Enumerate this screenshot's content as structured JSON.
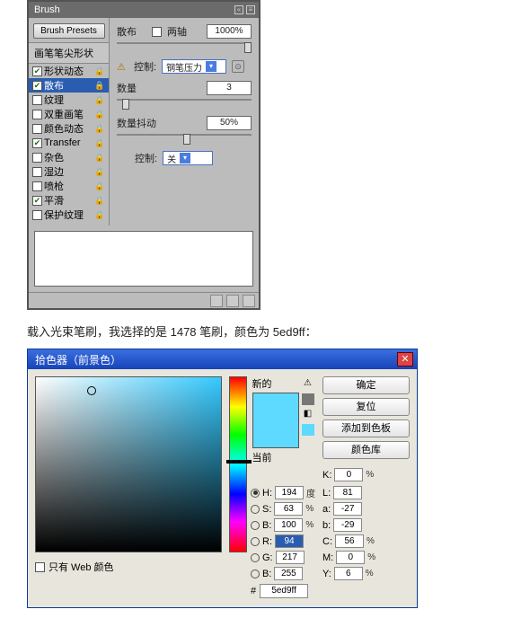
{
  "brush": {
    "title": "Brush",
    "presets_button": "Brush Presets",
    "sidebar_head": "画笔笔尖形状",
    "items": [
      {
        "label": "形状动态",
        "checked": true,
        "locked": true,
        "key": "shape-dynamics"
      },
      {
        "label": "散布",
        "checked": true,
        "locked": true,
        "key": "scatter",
        "selected": true
      },
      {
        "label": "纹理",
        "checked": false,
        "locked": true,
        "key": "texture"
      },
      {
        "label": "双重画笔",
        "checked": false,
        "locked": true,
        "key": "dual-brush"
      },
      {
        "label": "颜色动态",
        "checked": false,
        "locked": true,
        "key": "color-dynamics"
      },
      {
        "label": "Transfer",
        "checked": true,
        "locked": true,
        "key": "transfer"
      },
      {
        "label": "杂色",
        "checked": false,
        "locked": true,
        "key": "noise"
      },
      {
        "label": "湿边",
        "checked": false,
        "locked": true,
        "key": "wet-edges"
      },
      {
        "label": "喷枪",
        "checked": false,
        "locked": true,
        "key": "airbrush"
      },
      {
        "label": "平滑",
        "checked": true,
        "locked": true,
        "key": "smoothing"
      },
      {
        "label": "保护纹理",
        "checked": false,
        "locked": true,
        "key": "protect-texture"
      }
    ],
    "scatter": {
      "scatter_label": "散布",
      "both_axes_label": "两轴",
      "both_axes_checked": false,
      "scatter_value": "1000%",
      "control1_label": "控制:",
      "control1_value": "钢笔压力",
      "count_label": "数量",
      "count_value": "3",
      "jitter_label": "数量抖动",
      "jitter_value": "50%",
      "control2_label": "控制:",
      "control2_value": "关"
    }
  },
  "caption": "载入光束笔刷，我选择的是 1478 笔刷，颜色为 5ed9ff：",
  "picker": {
    "title": "拾色器（前景色）",
    "new_label": "新的",
    "current_label": "当前",
    "buttons": {
      "ok": "确定",
      "reset": "复位",
      "add_swatch": "添加到色板",
      "libraries": "颜色库"
    },
    "web_only_label": "只有 Web 颜色",
    "web_only_checked": false,
    "values": {
      "H": {
        "label": "H:",
        "value": "194",
        "unit": "度",
        "radio": true
      },
      "S": {
        "label": "S:",
        "value": "63",
        "unit": "%"
      },
      "B": {
        "label": "B:",
        "value": "100",
        "unit": "%"
      },
      "R": {
        "label": "R:",
        "value": "94",
        "unit": "",
        "selected": true
      },
      "G": {
        "label": "G:",
        "value": "217",
        "unit": ""
      },
      "Bb": {
        "label": "B:",
        "value": "255",
        "unit": ""
      },
      "L": {
        "label": "L:",
        "value": "81",
        "unit": ""
      },
      "a": {
        "label": "a:",
        "value": "-27",
        "unit": ""
      },
      "b2": {
        "label": "b:",
        "value": "-29",
        "unit": ""
      },
      "C": {
        "label": "C:",
        "value": "56",
        "unit": "%"
      },
      "M": {
        "label": "M:",
        "value": "0",
        "unit": "%"
      },
      "Y": {
        "label": "Y:",
        "value": "6",
        "unit": "%"
      },
      "K": {
        "label": "K:",
        "value": "0",
        "unit": "%"
      }
    },
    "hex_label": "#",
    "hex_value": "5ed9ff"
  }
}
